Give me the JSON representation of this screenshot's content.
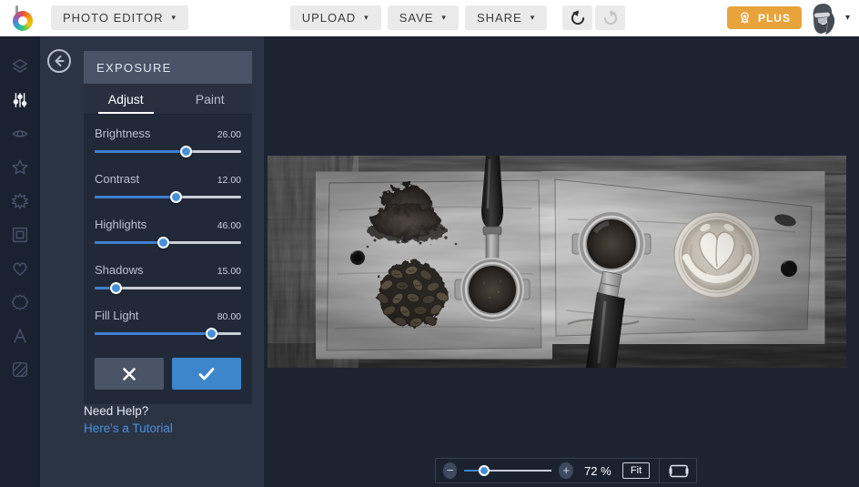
{
  "topbar": {
    "app_menu": "PHOTO EDITOR",
    "upload": "UPLOAD",
    "save": "SAVE",
    "share": "SHARE",
    "plus": "PLUS"
  },
  "icons": {
    "caret": "▾",
    "minus": "−",
    "plus": "+"
  },
  "sidebar": {
    "items": [
      {
        "icon": "layers-icon",
        "active": false
      },
      {
        "icon": "adjust-icon",
        "active": true
      },
      {
        "icon": "touchup-icon",
        "active": false
      },
      {
        "icon": "effects-icon",
        "active": false
      },
      {
        "icon": "artsy-icon",
        "active": false
      },
      {
        "icon": "frames-icon",
        "active": false
      },
      {
        "icon": "overlays-icon",
        "active": false
      },
      {
        "icon": "graphics-icon",
        "active": false
      },
      {
        "icon": "text-icon",
        "active": false
      },
      {
        "icon": "textures-icon",
        "active": false
      }
    ]
  },
  "panel": {
    "title": "EXPOSURE",
    "tabs": [
      {
        "label": "Adjust",
        "active": true
      },
      {
        "label": "Paint",
        "active": false
      }
    ],
    "sliders": [
      {
        "label": "Brightness",
        "value": "26.00",
        "percent": 63
      },
      {
        "label": "Contrast",
        "value": "12.00",
        "percent": 56
      },
      {
        "label": "Highlights",
        "value": "46.00",
        "percent": 47
      },
      {
        "label": "Shadows",
        "value": "15.00",
        "percent": 15
      },
      {
        "label": "Fill Light",
        "value": "80.00",
        "percent": 80
      }
    ],
    "help_text": "Need Help?",
    "help_link": "Here's a Tutorial"
  },
  "zoombar": {
    "value": "72 %",
    "fit": "Fit"
  },
  "colors": {
    "accent_blue": "#3f86cf",
    "plus_orange": "#e8a33b",
    "panel": "#2b3445",
    "sidebar": "#1a2130",
    "canvas": "#1c2432"
  }
}
